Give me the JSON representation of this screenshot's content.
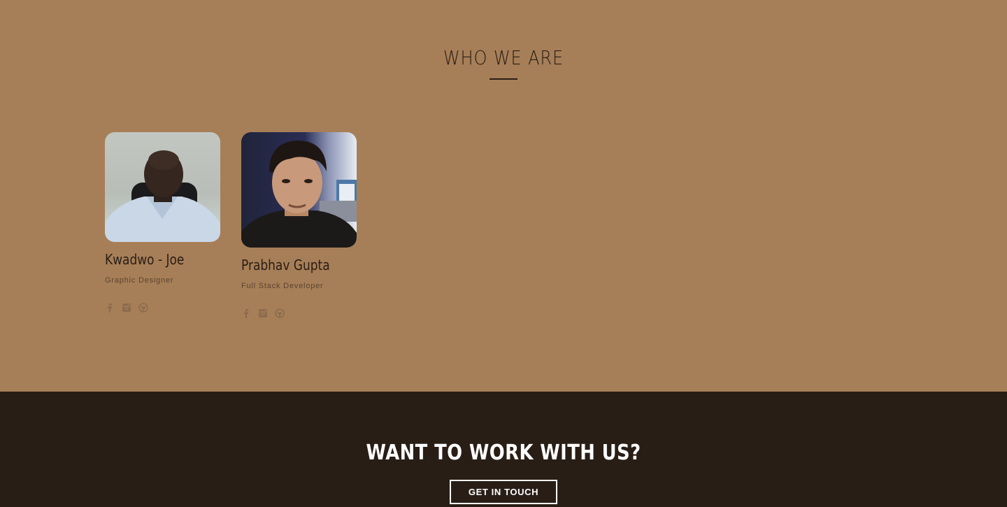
{
  "team_section": {
    "title": "WHO WE ARE",
    "members": [
      {
        "name": "Kwadwo - Joe",
        "role": "Graphic Designer",
        "socials": [
          "facebook-icon",
          "instagram-icon",
          "github-icon"
        ]
      },
      {
        "name": "Prabhav Gupta",
        "role": "Full Stack Developer",
        "socials": [
          "facebook-icon",
          "instagram-icon",
          "github-icon"
        ]
      }
    ]
  },
  "cta_section": {
    "title": "WANT TO WORK WITH US?",
    "button_label": "GET IN TOUCH"
  },
  "colors": {
    "team_background": "#a67f58",
    "cta_background": "#291e16",
    "heading_text": "#2a1d15",
    "icon": "#8c6b4d"
  }
}
